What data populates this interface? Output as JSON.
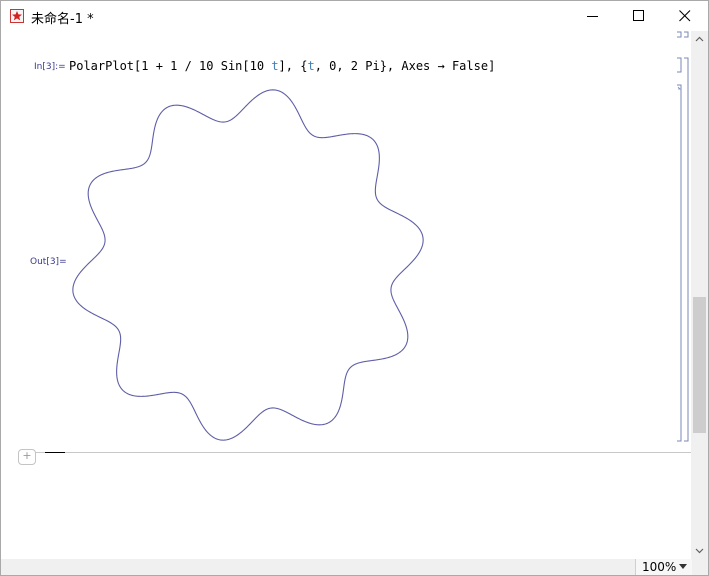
{
  "window": {
    "title": "未命名-1 *",
    "icon": "mathematica-icon",
    "controls": [
      "minimize-icon",
      "maximize-icon",
      "close-icon"
    ]
  },
  "notebook": {
    "input_label": "In[3]:=",
    "input_code": {
      "function": "PolarPlot",
      "part1": "[1 + 1 / 10 Sin[10 ",
      "var1": "t",
      "part2": "], {",
      "var2": "t",
      "part3": ", 0, 2 Pi}, Axes → False]"
    },
    "output_label": "Out[3]=",
    "plot": {
      "type": "polar",
      "expression": "1 + 1/10 Sin[10 t]",
      "t_range": [
        0,
        6.283185
      ],
      "axes": false,
      "curve_color": "#5e5ea8"
    },
    "add_cell_symbol": "+"
  },
  "status": {
    "zoom": "100%"
  }
}
